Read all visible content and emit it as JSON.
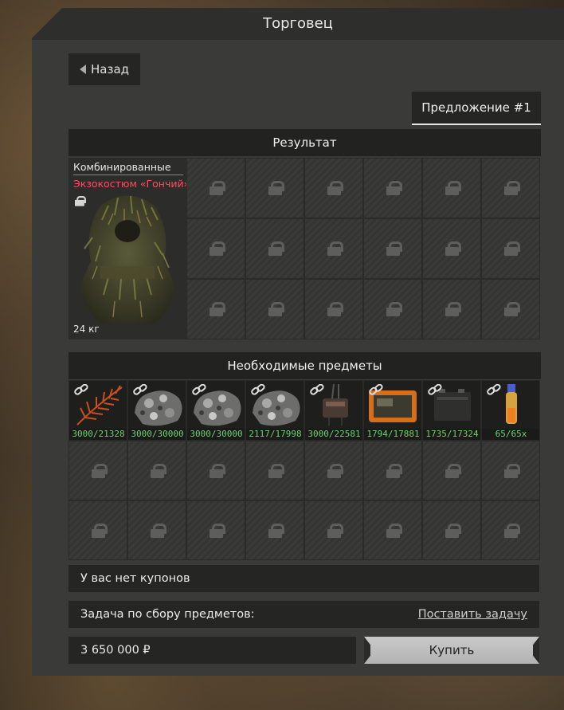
{
  "window": {
    "title": "Торговец"
  },
  "nav": {
    "back_label": "Назад"
  },
  "offer_tab": {
    "label": "Предложение #1"
  },
  "result": {
    "header": "Результат",
    "item": {
      "category": "Комбинированные",
      "name": "Экзокостюм «Гончий»",
      "weight": "24 кг"
    },
    "locked_slots": 18
  },
  "required": {
    "header": "Необходимые предметы",
    "items": [
      {
        "icon": "fern-icon",
        "count": "3000/21328"
      },
      {
        "icon": "ore-icon",
        "count": "3000/30000"
      },
      {
        "icon": "ore-icon",
        "count": "3000/30000"
      },
      {
        "icon": "ore-icon",
        "count": "2117/17998"
      },
      {
        "icon": "device-icon",
        "count": "3000/22581"
      },
      {
        "icon": "tablet-icon",
        "count": "1794/17881"
      },
      {
        "icon": "battery-icon",
        "count": "1735/17324"
      },
      {
        "icon": "vial-icon",
        "count": "65/65x"
      }
    ],
    "locked_slots": 16
  },
  "coupons": {
    "text": "У вас нет купонов"
  },
  "task": {
    "label": "Задача по сбору предметов:",
    "link": "Поставить задачу"
  },
  "purchase": {
    "price": "3 650 000 ₽",
    "buy_label": "Купить"
  },
  "colors": {
    "item_name": "#ff4d5e",
    "count_text": "#6fd26f",
    "button_bg": "#c0c0c0"
  }
}
